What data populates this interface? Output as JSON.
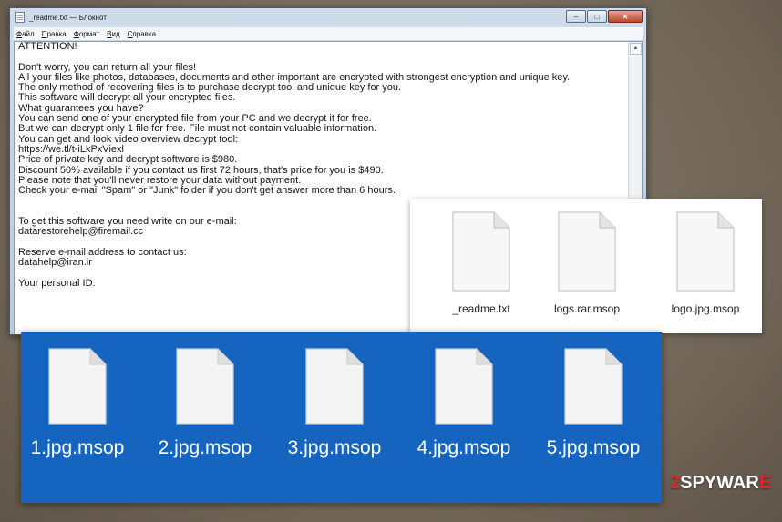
{
  "notepad": {
    "title": "_readme.txt — Блокнот",
    "menu": [
      "Файл",
      "Правка",
      "Формат",
      "Вид",
      "Справка"
    ],
    "lines": [
      "ATTENTION!",
      "",
      "Don't worry, you can return all your files!",
      "All your files like photos, databases, documents and other important are encrypted with strongest encryption and unique key.",
      "The only method of recovering files is to purchase decrypt tool and unique key for you.",
      "This software will decrypt all your encrypted files.",
      "What guarantees you have?",
      "You can send one of your encrypted file from your PC and we decrypt it for free.",
      "But we can decrypt only 1 file for free. File must not contain valuable information.",
      "You can get and look video overview decrypt tool:",
      "https://we.tl/t-iLkPxViexl",
      "Price of private key and decrypt software is $980.",
      "Discount 50% available if you contact us first 72 hours, that's price for you is $490.",
      "Please note that you'll never restore your data without payment.",
      "Check your e-mail \"Spam\" or \"Junk\" folder if you don't get answer more than 6 hours.",
      "",
      "",
      "To get this software you need write on our e-mail:",
      "datarestorehelp@firemail.cc",
      "",
      "Reserve e-mail address to contact us:",
      "datahelp@iran.ir",
      "",
      "Your personal ID:"
    ]
  },
  "files_panel": {
    "files": [
      {
        "name": "_readme.txt",
        "icon": "document-icon"
      },
      {
        "name": "logs.rar.msop",
        "icon": "document-icon"
      },
      {
        "name": "logo.jpg.msop",
        "icon": "document-icon"
      }
    ]
  },
  "blue_panel": {
    "files": [
      {
        "name": "1.jpg.msop",
        "icon": "document-icon"
      },
      {
        "name": "2.jpg.msop",
        "icon": "document-icon"
      },
      {
        "name": "3.jpg.msop",
        "icon": "document-icon"
      },
      {
        "name": "4.jpg.msop",
        "icon": "document-icon"
      },
      {
        "name": "5.jpg.msop",
        "icon": "document-icon"
      }
    ]
  },
  "watermark": {
    "number": "2",
    "text": "SPYWAR",
    "suffix": "E"
  },
  "colors": {
    "blue_panel_bg": "#1565c0",
    "watermark_red": "#d8262c",
    "background": "#7a6e5f"
  }
}
